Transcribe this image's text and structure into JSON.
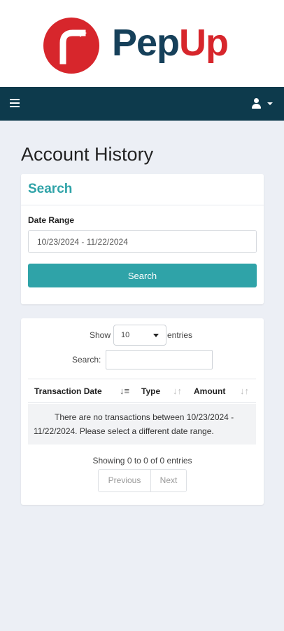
{
  "brand": {
    "name_part1": "Pep",
    "name_part2": "Up",
    "logo_color": "#d7262c",
    "text_color": "#16405a"
  },
  "navbar": {
    "background": "#0d3a4c",
    "menu_icon": "hamburger-icon",
    "user_icon": "user-icon"
  },
  "page": {
    "title": "Account History"
  },
  "search_panel": {
    "title": "Search",
    "date_range_label": "Date Range",
    "date_range_value": "10/23/2024 - 11/22/2024",
    "button_label": "Search",
    "accent": "#2fa3a8"
  },
  "table": {
    "show_label": "Show",
    "length_value": "10",
    "entries_label": "entries",
    "search_label": "Search:",
    "search_value": "",
    "columns": [
      "Transaction Date",
      "Type",
      "Amount"
    ],
    "empty_line1": "There are no transactions between 10/23/2024 -",
    "empty_line2": "11/22/2024. Please select a different date range.",
    "info": "Showing 0 to 0 of 0 entries",
    "prev_label": "Previous",
    "next_label": "Next"
  }
}
